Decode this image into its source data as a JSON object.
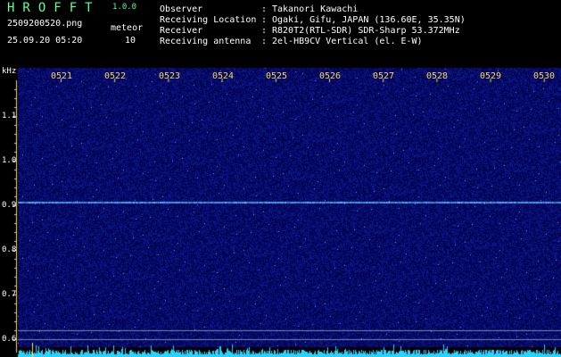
{
  "app": {
    "name": "HROFFT",
    "version": "1.0.0"
  },
  "file": {
    "name": "2509200520.png",
    "datetime": "25.09.20 05:20"
  },
  "meteor": {
    "label": "meteor",
    "count": "10"
  },
  "info": [
    {
      "label": "Observer",
      "value": "Takanori Kawachi"
    },
    {
      "label": "Receiving Location",
      "value": "Ogaki, Gifu, JAPAN (136.60E, 35.35N)"
    },
    {
      "label": "Receiver",
      "value": "R820T2(RTL-SDR) SDR-Sharp 53.372MHz"
    },
    {
      "label": "Receiving antenna",
      "value": "2el-HB9CV Vertical (el. E-W)"
    }
  ],
  "axis": {
    "unit": "kHz",
    "time_ticks": [
      "0521",
      "0522",
      "0523",
      "0524",
      "0525",
      "0526",
      "0527",
      "0528",
      "0529",
      "0530"
    ],
    "freq_ticks": [
      "1.1",
      "1.0",
      "0.9",
      "0.8",
      "0.7",
      "0.6"
    ]
  },
  "colors": {
    "background": "#0a0a5a",
    "signal": "#7fd0ff",
    "tick_text": "#ffd84a",
    "title": "#5cff9a",
    "baseline": "#29d3ff"
  }
}
